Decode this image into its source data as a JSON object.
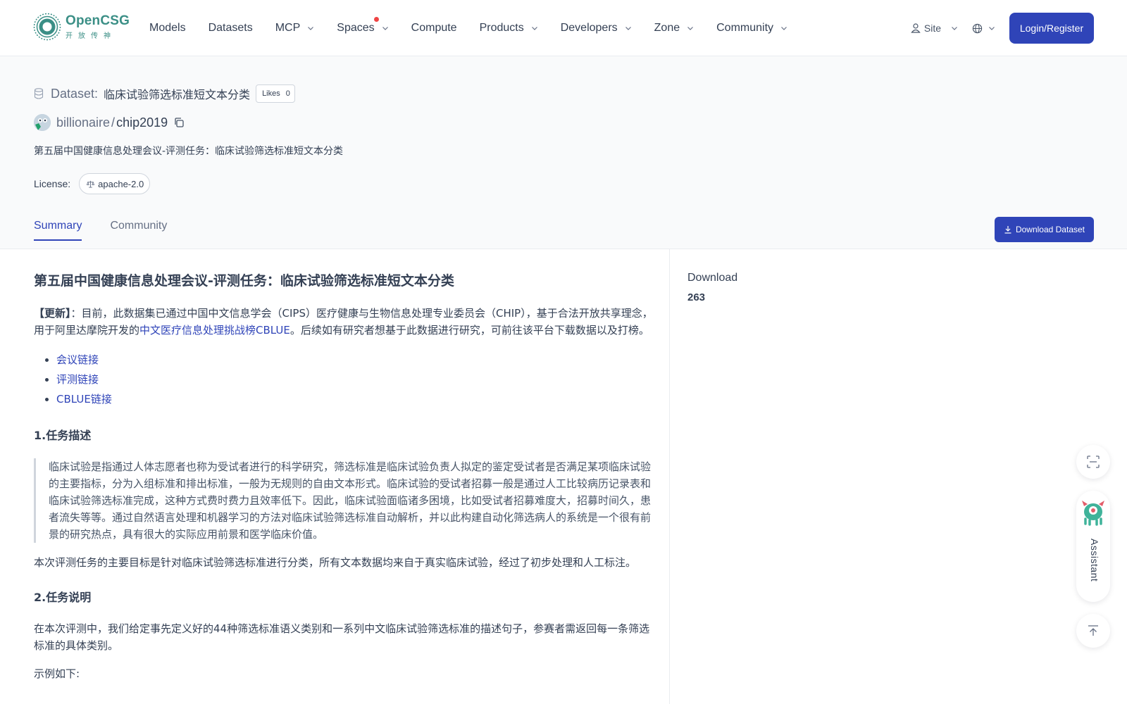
{
  "brand": {
    "name": "OpenCSG",
    "subtitle": "开放传神",
    "accent": "#3b8f86",
    "primary": "#2f44b8"
  },
  "nav": {
    "items": [
      {
        "label": "Models",
        "has_menu": false
      },
      {
        "label": "Datasets",
        "has_menu": false
      },
      {
        "label": "MCP",
        "has_menu": true
      },
      {
        "label": "Spaces",
        "has_menu": true,
        "badge_dot": true
      },
      {
        "label": "Compute",
        "has_menu": false
      },
      {
        "label": "Products",
        "has_menu": true
      },
      {
        "label": "Developers",
        "has_menu": true
      },
      {
        "label": "Zone",
        "has_menu": true
      },
      {
        "label": "Community",
        "has_menu": true
      }
    ],
    "site_label": "Site",
    "login_label": "Login/Register"
  },
  "dataset": {
    "label": "Dataset:",
    "name": "临床试验筛选标准短文本分类",
    "likes_label": "Likes",
    "likes_count": "0",
    "owner": "billionaire",
    "separator": "/",
    "repo": "chip2019",
    "description": "第五届中国健康信息处理会议-评测任务：临床试验筛选标准短文本分类",
    "license_label": "License:",
    "license": "apache-2.0"
  },
  "tabs": [
    {
      "label": "Summary",
      "active": true
    },
    {
      "label": "Community",
      "active": false
    }
  ],
  "download_button_label": "Download Dataset",
  "content": {
    "h1": "第五届中国健康信息处理会议-评测任务：临床试验筛选标准短文本分类",
    "update_bold": "【更新】",
    "update_text_1": "：目前，此数据集已通过中国中文信息学会（CIPS）医疗健康与生物信息处理专业委员会（CHIP），基于合法开放共享理念，用于阿里达摩院开发的",
    "update_link": "中文医疗信息处理挑战榜CBLUE",
    "update_text_2": "。后续如有研究者想基于此数据进行研究，可前往该平台下载数据以及打榜。",
    "links": [
      "会议链接",
      "评测链接",
      "CBLUE链接"
    ],
    "section1_title": "1.任务描述",
    "section1_quote": "临床试验是指通过人体志愿者也称为受试者进行的科学研究，筛选标准是临床试验负责人拟定的鉴定受试者是否满足某项临床试验的主要指标，分为入组标准和排出标准，一般为无规则的自由文本形式。临床试验的受试者招募一般是通过人工比较病历记录表和临床试验筛选标准完成，这种方式费时费力且效率低下。因此，临床试验面临诸多困境，比如受试者招募难度大，招募时间久，患者流失等等。通过自然语言处理和机器学习的方法对临床试验筛选标准自动解析，并以此构建自动化筛选病人的系统是一个很有前景的研究热点，具有很大的实际应用前景和医学临床价值。",
    "section1_goal": "本次评测任务的主要目标是针对临床试验筛选标准进行分类，所有文本数据均来自于真实临床试验，经过了初步处理和人工标注。",
    "section2_title": "2.任务说明",
    "section2_text": "在本次评测中，我们给定事先定义好的44种筛选标准语义类别和一系列中文临床试验筛选标准的描述句子，参赛者需返回每一条筛选标准的具体类别。",
    "example_intro": "示例如下:"
  },
  "sidebar": {
    "download_label": "Download",
    "download_count": "263"
  },
  "assistant_label": "Assistant"
}
